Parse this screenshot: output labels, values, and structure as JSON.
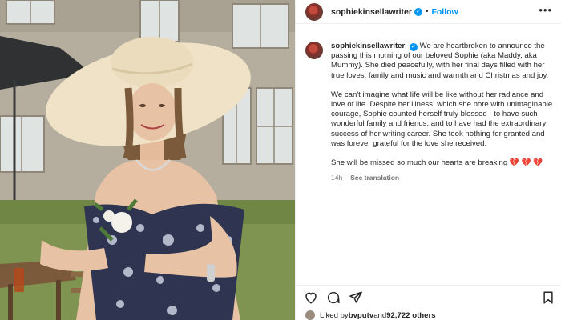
{
  "header": {
    "username": "sophiekinsellawriter",
    "separator": "•",
    "follow_label": "Follow",
    "more_glyph": "•••"
  },
  "caption": {
    "username": "sophiekinsellawriter",
    "paragraphs": [
      "We are heartbroken to announce the passing this morning of our beloved Sophie (aka Maddy, aka Mummy). She died peacefully, with her final days filled with her true loves: family and music and warmth and Christmas and joy.",
      "We can't imagine what life will be like without her radiance and love of life. Despite her illness, which she bore with unimaginable courage, Sophie counted herself truly blessed - to have such wonderful family and friends, and to have had the extraordinary success of her writing career. She took nothing for granted and was forever grateful for the love she received.",
      "She will be missed so much our hearts are breaking 💔 💔 💔"
    ],
    "time": "14h",
    "translate_label": "See translation"
  },
  "actions": {
    "icons": [
      "heart-icon",
      "comment-icon",
      "share-icon",
      "bookmark-icon"
    ]
  },
  "likes": {
    "prefix": "Liked by ",
    "user": "bvputv",
    "middle": " and ",
    "count": "92,722 others"
  },
  "colors": {
    "accent": "#0095f6",
    "text": "#262626",
    "muted": "#737373"
  }
}
